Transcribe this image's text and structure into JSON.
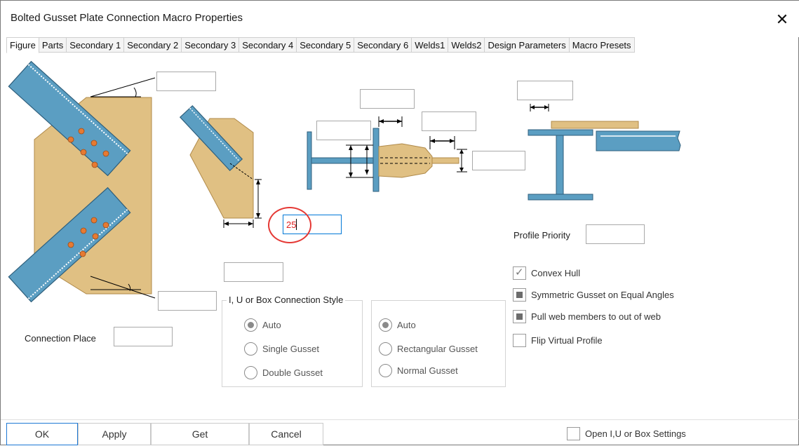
{
  "window": {
    "title": "Bolted Gusset Plate Connection Macro Properties",
    "close_label": "✕"
  },
  "tabs": [
    {
      "label": "Figure",
      "active": true
    },
    {
      "label": "Parts"
    },
    {
      "label": "Secondary 1"
    },
    {
      "label": "Secondary 2"
    },
    {
      "label": "Secondary 3"
    },
    {
      "label": "Secondary 4"
    },
    {
      "label": "Secondary 5"
    },
    {
      "label": "Secondary 6"
    },
    {
      "label": "Welds1"
    },
    {
      "label": "Welds2"
    },
    {
      "label": "Design Parameters"
    },
    {
      "label": "Macro Presets"
    }
  ],
  "fields": {
    "angle_top": "",
    "angle_bottom": "",
    "gusset_distance": "25",
    "setback": "",
    "web_depth": "",
    "plate_width": "",
    "plate_thickness": "",
    "plate_extension": "",
    "flange_offset": ""
  },
  "connection_place": {
    "label": "Connection Place",
    "value": ""
  },
  "profile_priority": {
    "label": "Profile Priority",
    "value": ""
  },
  "style_group": {
    "legend": "I, U or Box Connection Style",
    "options": [
      "Auto",
      "Single Gusset",
      "Double Gusset"
    ],
    "selected": "Auto"
  },
  "shape_group": {
    "options": [
      "Auto",
      "Rectangular Gusset",
      "Normal Gusset"
    ],
    "selected": "Auto"
  },
  "checkboxes": [
    {
      "label": "Convex Hull",
      "state": "checked"
    },
    {
      "label": "Symmetric Gusset on Equal Angles",
      "state": "indeterminate"
    },
    {
      "label": "Pull web members to out of web",
      "state": "indeterminate"
    },
    {
      "label": "Flip Virtual Profile",
      "state": "unchecked"
    }
  ],
  "buttons": {
    "ok": "OK",
    "apply": "Apply",
    "get": "Get",
    "cancel": "Cancel"
  },
  "open_settings": {
    "label": "Open I,U or Box Settings",
    "state": "unchecked"
  },
  "colors": {
    "steel_blue": "#5b9ec2",
    "gusset_tan": "#e0c083",
    "bolt_orange": "#e67a32",
    "highlight_circle": "#e53935",
    "focus_blue": "#0078d7"
  },
  "icons": [
    "close-icon",
    "gusset-diagram",
    "beam-section-diagram",
    "i-beam-profile-diagram"
  ]
}
